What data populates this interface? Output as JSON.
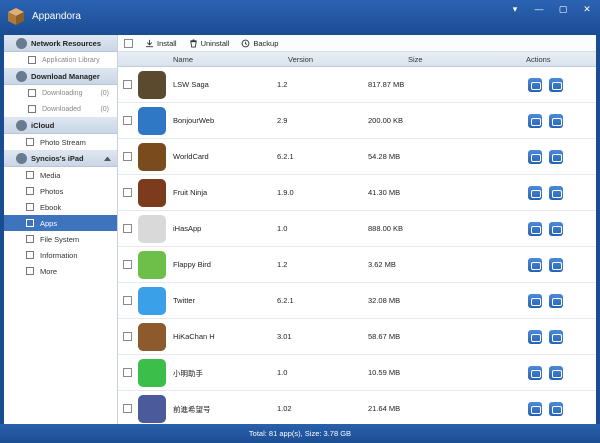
{
  "window": {
    "title": "Appandora",
    "controls": [
      "▾",
      "—",
      "▢",
      "✕"
    ]
  },
  "sidebar": {
    "sections": [
      {
        "label": "Network Resources",
        "items": [
          {
            "label": "Application Library",
            "count": ""
          }
        ]
      },
      {
        "label": "Download Manager",
        "items": [
          {
            "label": "Downloading",
            "count": "(0)"
          },
          {
            "label": "Downloaded",
            "count": "(0)"
          }
        ]
      },
      {
        "label": "iCloud",
        "items": [
          {
            "label": "Photo Stream",
            "count": ""
          }
        ]
      },
      {
        "label": "Syncios's iPad",
        "items": [
          {
            "label": "Media"
          },
          {
            "label": "Photos"
          },
          {
            "label": "Ebook"
          },
          {
            "label": "Apps"
          },
          {
            "label": "File System"
          },
          {
            "label": "Information"
          },
          {
            "label": "More"
          }
        ]
      }
    ]
  },
  "toolbar": {
    "install": "Install",
    "uninstall": "Uninstall",
    "backup": "Backup"
  },
  "columns": {
    "name": "Name",
    "version": "Version",
    "size": "Size",
    "actions": "Actions"
  },
  "apps": [
    {
      "name": "LSW Saga",
      "version": "1.2",
      "size": "817.87 MB",
      "color": "#5b4a2e"
    },
    {
      "name": "BonjourWeb",
      "version": "2.9",
      "size": "200.00 KB",
      "color": "#2f78c6"
    },
    {
      "name": "WorldCard",
      "version": "6.2.1",
      "size": "54.28 MB",
      "color": "#7a4b1d"
    },
    {
      "name": "Fruit Ninja",
      "version": "1.9.0",
      "size": "41.30 MB",
      "color": "#7c3b1c"
    },
    {
      "name": "iHasApp",
      "version": "1.0",
      "size": "888.00 KB",
      "color": "#d9d9d9"
    },
    {
      "name": "Flappy Bird",
      "version": "1.2",
      "size": "3.62 MB",
      "color": "#6cc04a"
    },
    {
      "name": "Twitter",
      "version": "6.2.1",
      "size": "32.08 MB",
      "color": "#3aa1e8"
    },
    {
      "name": "HiKaChan H",
      "version": "3.01",
      "size": "58.67 MB",
      "color": "#8c5a2c"
    },
    {
      "name": "小明助手",
      "version": "1.0",
      "size": "10.59 MB",
      "color": "#3cbf4a"
    },
    {
      "name": "前進希望号",
      "version": "1.02",
      "size": "21.64 MB",
      "color": "#4a5a9a"
    }
  ],
  "status": {
    "text": "Total: 81 app(s), Size: 3.78 GB"
  }
}
